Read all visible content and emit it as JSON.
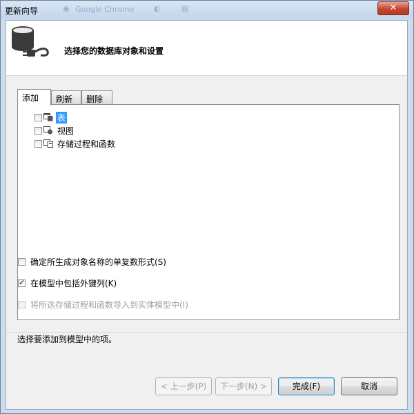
{
  "window": {
    "title": "更新向导",
    "ghost_title": "Google Chrome",
    "close_label": "✕"
  },
  "header": {
    "title": "选择您的数据库对象和设置"
  },
  "tabs": [
    {
      "label": "添加"
    },
    {
      "label": "刷新"
    },
    {
      "label": "删除"
    }
  ],
  "tree": [
    {
      "label": "表",
      "checked": false,
      "selected": true,
      "icon": "table-icon"
    },
    {
      "label": "视图",
      "checked": false,
      "selected": false,
      "icon": "view-icon"
    },
    {
      "label": "存储过程和函数",
      "checked": false,
      "selected": false,
      "icon": "procedure-icon"
    }
  ],
  "options": {
    "pluralize": {
      "label": "确定所生成对象名称的单复数形式(S)",
      "checked": false,
      "enabled": true
    },
    "foreign_keys": {
      "label": "在模型中包括外键列(K)",
      "checked": true,
      "enabled": true
    },
    "import_procs": {
      "label": "将所选存储过程和函数导入到实体模型中(I)",
      "checked": false,
      "enabled": false
    }
  },
  "status": {
    "text": "选择要添加到模型中的项。"
  },
  "buttons": {
    "back": "< 上一步(P)",
    "next": "下一步(N) >",
    "finish": "完成(F)",
    "cancel": "取消"
  },
  "colors": {
    "selection": "#3399ff",
    "title_bar": "#c9d9ee",
    "close": "#c7442e"
  }
}
